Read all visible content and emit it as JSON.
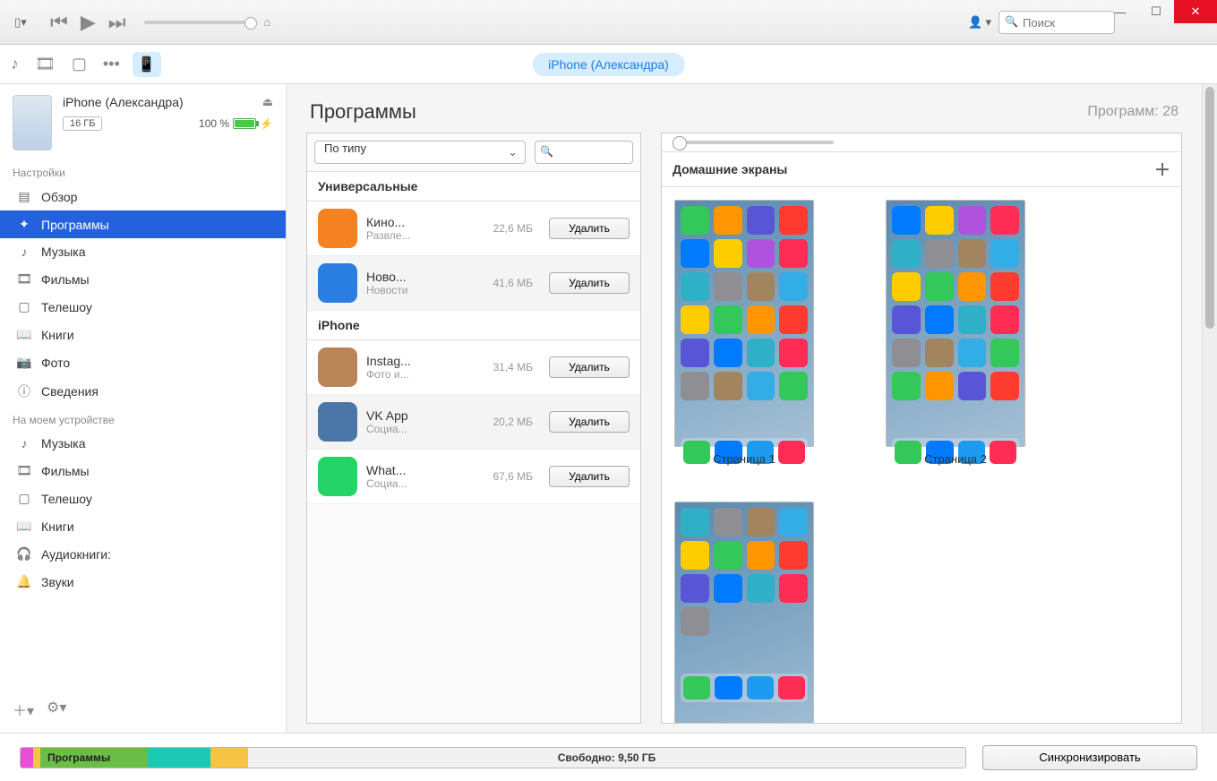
{
  "titlebar": {
    "search_placeholder": "Поиск"
  },
  "device_pill": "iPhone (Александра)",
  "sidebar": {
    "device": {
      "name": "iPhone (Александра)",
      "storage": "16 ГБ",
      "battery": "100 %"
    },
    "section_settings": "Настройки",
    "nav_settings": [
      {
        "label": "Обзор",
        "icon": "▤"
      },
      {
        "label": "Программы",
        "icon": "✦"
      },
      {
        "label": "Музыка",
        "icon": "♪"
      },
      {
        "label": "Фильмы",
        "icon": "🎞"
      },
      {
        "label": "Телешоу",
        "icon": "▢"
      },
      {
        "label": "Книги",
        "icon": "📖"
      },
      {
        "label": "Фото",
        "icon": "📷"
      },
      {
        "label": "Сведения",
        "icon": "ⓘ"
      }
    ],
    "section_device": "На моем устройстве",
    "nav_device": [
      {
        "label": "Музыка",
        "icon": "♪"
      },
      {
        "label": "Фильмы",
        "icon": "🎞"
      },
      {
        "label": "Телешоу",
        "icon": "▢"
      },
      {
        "label": "Книги",
        "icon": "📖"
      },
      {
        "label": "Аудиокниги:",
        "icon": "🎧"
      },
      {
        "label": "Звуки",
        "icon": "🔔"
      }
    ]
  },
  "content": {
    "title": "Программы",
    "count_label": "Программ: 28",
    "sort_label": "По типу",
    "group_universal": "Универсальные",
    "group_iphone": "iPhone",
    "delete_label": "Удалить",
    "apps_universal": [
      {
        "name": "Кино...",
        "category": "Развле...",
        "size": "22,6 МБ",
        "color": "#f58220"
      },
      {
        "name": "Ново...",
        "category": "Новости",
        "size": "41,6 МБ",
        "color": "#2a7de1"
      }
    ],
    "apps_iphone": [
      {
        "name": "Instag...",
        "category": "Фото и...",
        "size": "31,4 МБ",
        "color": "#b88458"
      },
      {
        "name": "VK App",
        "category": "Социа...",
        "size": "20,2 МБ",
        "color": "#4a76a8"
      },
      {
        "name": "What...",
        "category": "Социа...",
        "size": "67,6 МБ",
        "color": "#25d366"
      }
    ]
  },
  "screens": {
    "header": "Домашние экраны",
    "pages": [
      {
        "label": "Страница 1"
      },
      {
        "label": "Страница 2"
      },
      {
        "label": ""
      }
    ]
  },
  "footer": {
    "storage_seg_label": "Программы",
    "free_label": "Свободно: 9,50 ГБ",
    "sync_label": "Синхронизировать"
  },
  "icon_colors": [
    "#34c759",
    "#ff9500",
    "#5856d6",
    "#ff3b30",
    "#007aff",
    "#ffcc00",
    "#af52de",
    "#ff2d55",
    "#30b0c7",
    "#8e8e93",
    "#a2845e",
    "#32ade6",
    "#ffcc00",
    "#34c759",
    "#ff9500",
    "#ff3b30",
    "#5856d6",
    "#007aff",
    "#30b0c7",
    "#ff2d55",
    "#8e8e93",
    "#a2845e",
    "#32ade6",
    "#34c759"
  ]
}
